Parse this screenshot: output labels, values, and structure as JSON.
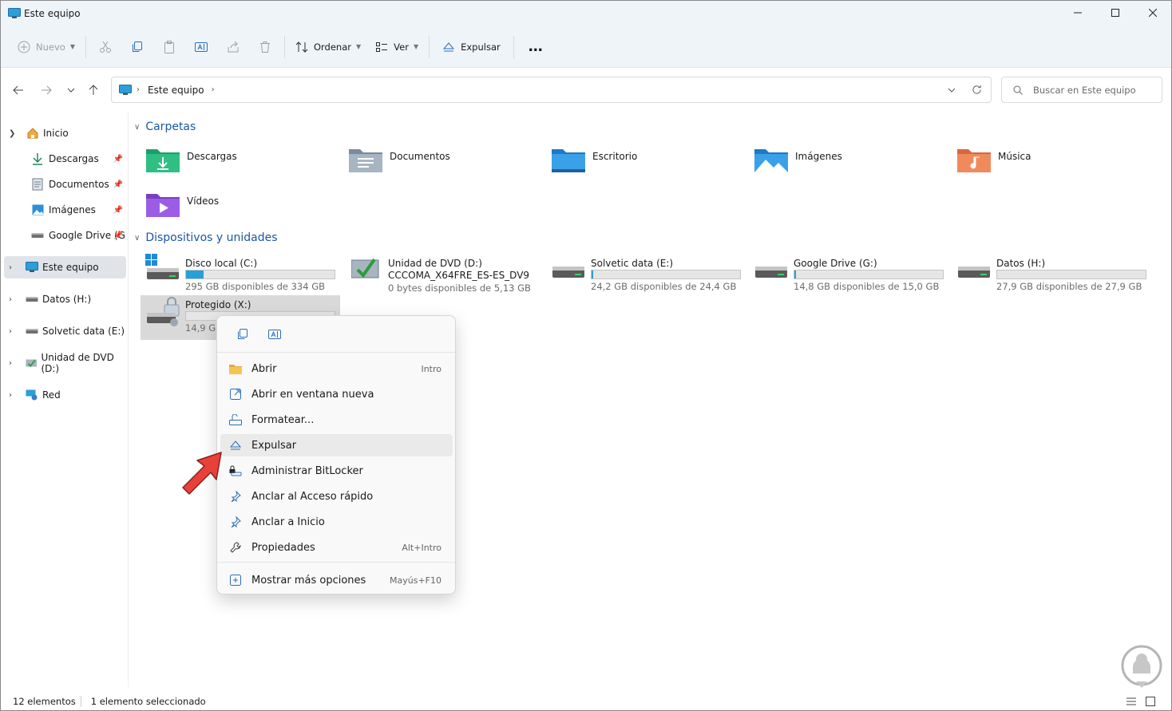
{
  "window": {
    "title": "Este equipo"
  },
  "toolbar": {
    "new_label": "Nuevo",
    "sort_label": "Ordenar",
    "view_label": "Ver",
    "eject_label": "Expulsar",
    "more_label": "…"
  },
  "address": {
    "crumb": "Este equipo",
    "search_placeholder": "Buscar en Este equipo"
  },
  "sidebar": {
    "items": [
      {
        "label": "Inicio"
      },
      {
        "label": "Descargas"
      },
      {
        "label": "Documentos"
      },
      {
        "label": "Imágenes"
      },
      {
        "label": "Google Drive (G"
      },
      {
        "label": "Este equipo"
      },
      {
        "label": "Datos (H:)"
      },
      {
        "label": "Solvetic data (E:)"
      },
      {
        "label": "Unidad de DVD (D:)"
      },
      {
        "label": "Red"
      }
    ]
  },
  "main": {
    "folders_header": "Carpetas",
    "devices_header": "Dispositivos y unidades",
    "folders": [
      {
        "name": "Descargas",
        "icon": "downloads-folder-icon"
      },
      {
        "name": "Documentos",
        "icon": "documents-folder-icon"
      },
      {
        "name": "Escritorio",
        "icon": "desktop-folder-icon"
      },
      {
        "name": "Imágenes",
        "icon": "pictures-folder-icon"
      },
      {
        "name": "Música",
        "icon": "music-folder-icon"
      },
      {
        "name": "Vídeos",
        "icon": "videos-folder-icon"
      }
    ],
    "drives": [
      {
        "name": "Disco local (C:)",
        "free": "295 GB disponibles de 334 GB",
        "used_fraction": 0.12
      },
      {
        "name": "Unidad de DVD (D:)",
        "label2": "CCCOMA_X64FRE_ES-ES_DV9",
        "free": "0 bytes disponibles de 5,13 GB"
      },
      {
        "name": "Solvetic data (E:)",
        "free": "24,2 GB disponibles de 24,4 GB",
        "used_fraction": 0.01
      },
      {
        "name": "Google Drive (G:)",
        "free": "14,8 GB disponibles de 15,0 GB",
        "used_fraction": 0.01
      },
      {
        "name": "Datos (H:)",
        "free": "27,9 GB disponibles de 27,9 GB",
        "used_fraction": 0.0
      },
      {
        "name": "Protegido (X:)",
        "free": "14,9 GB",
        "used_fraction": 0.0
      }
    ]
  },
  "context_menu": {
    "items": [
      {
        "label": "Abrir",
        "shortcut": "Intro",
        "icon": "open-folder-icon"
      },
      {
        "label": "Abrir en ventana nueva",
        "shortcut": "",
        "icon": "new-window-icon"
      },
      {
        "label": "Formatear...",
        "shortcut": "",
        "icon": "format-icon"
      },
      {
        "label": "Expulsar",
        "shortcut": "",
        "icon": "eject-icon"
      },
      {
        "label": "Administrar BitLocker",
        "shortcut": "",
        "icon": "bitlocker-icon"
      },
      {
        "label": "Anclar al Acceso rápido",
        "shortcut": "",
        "icon": "pin-icon"
      },
      {
        "label": "Anclar a Inicio",
        "shortcut": "",
        "icon": "pin-icon"
      },
      {
        "label": "Propiedades",
        "shortcut": "Alt+Intro",
        "icon": "wrench-icon"
      },
      {
        "label": "Mostrar más opciones",
        "shortcut": "Mayús+F10",
        "icon": "more-options-icon"
      }
    ]
  },
  "status": {
    "count": "12 elementos",
    "selected": "1 elemento seleccionado"
  },
  "colors": {
    "accent": "#1a57a4",
    "bar_fill": "#26a0da",
    "arrow": "#e8413a"
  }
}
